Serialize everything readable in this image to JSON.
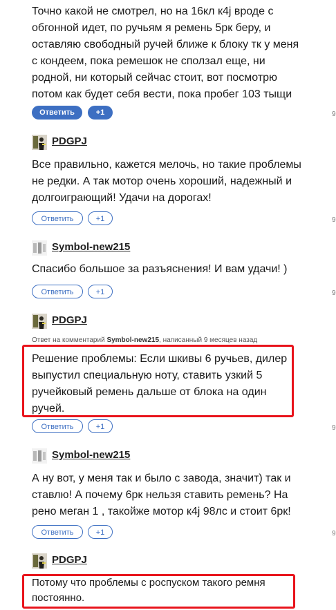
{
  "comments": [
    {
      "text": "Точно какой не смотрел, но на 16кл к4j вроде с обгонной идет, по ручьям я ремень 5рк беру, и оставляю свободный ручей ближе к блоку тк у меня с кондеем, пока ремешок не сползал еще, ни родной, ни который сейчас стоит, вот посмотрю потом как будет себя вести, пока пробег 103 тыщи",
      "reply_label": "Ответить",
      "plus_label": "+1"
    },
    {
      "author": "PDGPJ",
      "text": "Все правильно, кажется мелочь, но такие проблемы не редки. А так мотор очень хороший, надежный и долгоиграющий! Удачи на дорогах!",
      "reply_label": "Ответить",
      "plus_label": "+1"
    },
    {
      "author": "Symbol-new215",
      "text": "Спасибо большое за разъяснения! И вам удачи! )",
      "reply_label": "Ответить",
      "plus_label": "+1"
    },
    {
      "author": "PDGPJ",
      "meta_prefix": "Ответ на комментарий",
      "meta_user": "Symbol-new215",
      "meta_suffix": ", написанный 9 месяцев назад",
      "text": "Решение проблемы: Если шкивы 6 ручьев, дилер выпустил специальную ноту, ставить узкий 5 ручейковый ремень дальше от блока на один ручей.",
      "reply_label": "Ответить",
      "plus_label": "+1"
    },
    {
      "author": "Symbol-new215",
      "text": "А ну вот, у меня так и было с завода, значит) так и ставлю! А почему 6рк нельзя ставить ремень? На рено меган 1 , такойже мотор к4j 98лс и стоит 6рк!",
      "reply_label": "Ответить",
      "plus_label": "+1"
    },
    {
      "author": "PDGPJ",
      "text": "Потому что проблемы с роспуском такого ремня постоянно."
    }
  ],
  "edge_fragments": [
    "9",
    "9",
    "9",
    "9",
    "9"
  ],
  "colors": {
    "accent": "#3d6fc2",
    "highlight": "#e8131b"
  }
}
